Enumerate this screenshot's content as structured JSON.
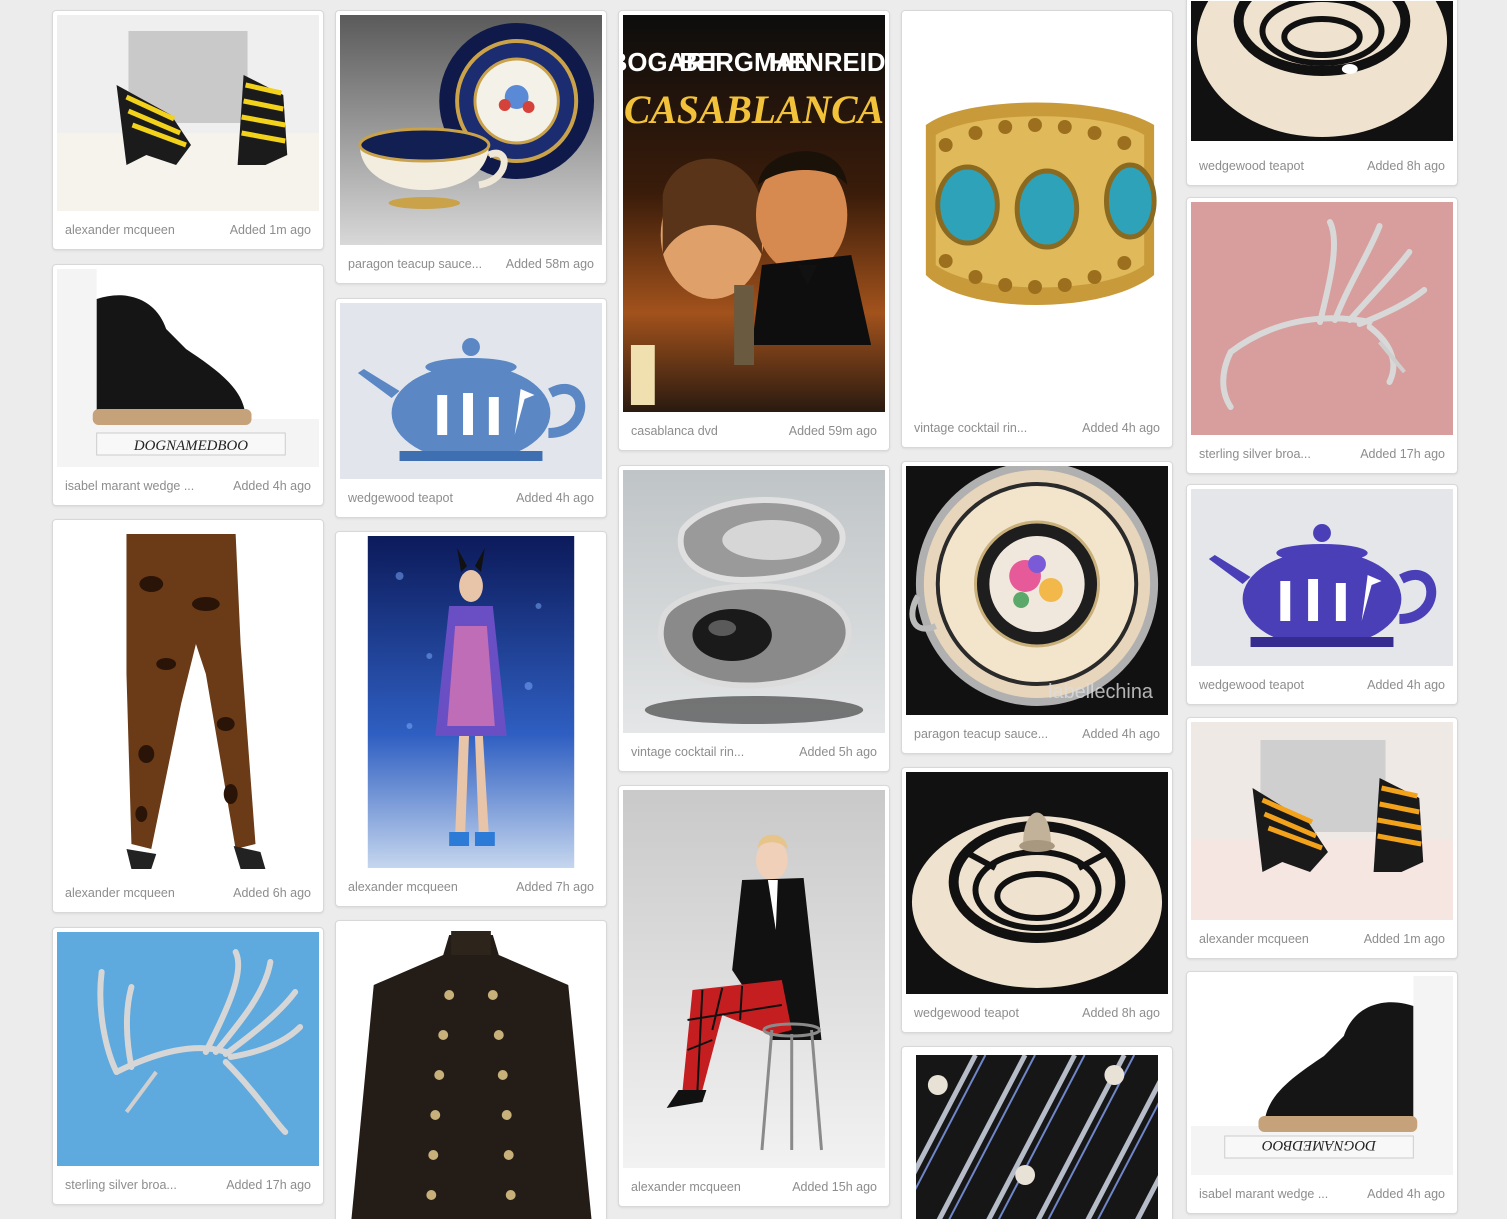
{
  "columns": [
    [
      {
        "title": "alexander mcqueen",
        "added": "Added 1m ago",
        "icon": "yellow-striped-sandals-image"
      },
      {
        "title": "isabel marant wedge ...",
        "added": "Added 4h ago",
        "icon": "black-wedge-sneaker-image",
        "img_text": "DOGNAMEDBOO"
      },
      {
        "title": "alexander mcqueen",
        "added": "Added 6h ago",
        "icon": "animal-print-leggings-image"
      },
      {
        "title": "sterling silver broa...",
        "added": "Added 17h ago",
        "icon": "hummingbird-brooch-image"
      }
    ],
    [
      {
        "title": "paragon teacup sauce...",
        "added": "Added 58m ago",
        "icon": "teacup-saucer-image"
      },
      {
        "title": "wedgewood teapot",
        "added": "Added 4h ago",
        "icon": "blue-teapot-image"
      },
      {
        "title": "alexander mcqueen",
        "added": "Added 7h ago",
        "icon": "runway-model-image"
      },
      {
        "title": "",
        "added": "",
        "icon": "military-leather-jacket-image"
      }
    ],
    [
      {
        "title": "casablanca dvd",
        "added": "Added 59m ago",
        "icon": "casablanca-poster-image",
        "poster": {
          "names": [
            "BOGART",
            "BERGMAN",
            "HENREID"
          ],
          "title": "CASABLANCA"
        }
      },
      {
        "title": "vintage cocktail rin...",
        "added": "Added 5h ago",
        "icon": "silver-cocktail-ring-image"
      },
      {
        "title": "alexander mcqueen",
        "added": "Added 15h ago",
        "icon": "tartan-trousers-model-image"
      }
    ],
    [
      {
        "title": "vintage cocktail rin...",
        "added": "Added 4h ago",
        "icon": "turquoise-gold-ring-image"
      },
      {
        "title": "paragon teacup sauce...",
        "added": "Added 4h ago",
        "icon": "floral-teacup-image",
        "img_text": "labellechina"
      },
      {
        "title": "wedgewood teapot",
        "added": "Added 8h ago",
        "icon": "teapot-lid-image"
      },
      {
        "title": "",
        "added": "",
        "icon": "skull-striped-fabric-image"
      }
    ],
    [
      {
        "title": "wedgewood teapot",
        "added": "Added 8h ago",
        "icon": "teapot-lid-image"
      },
      {
        "title": "sterling silver broa...",
        "added": "Added 17h ago",
        "icon": "hummingbird-brooch-image"
      },
      {
        "title": "wedgewood teapot",
        "added": "Added 4h ago",
        "icon": "purple-teapot-image"
      },
      {
        "title": "alexander mcqueen",
        "added": "Added 1m ago",
        "icon": "orange-striped-sandals-image"
      },
      {
        "title": "isabel marant wedge ...",
        "added": "Added 4h ago",
        "icon": "black-wedge-sneaker-image",
        "img_text": "DOGNAMEDBOO"
      }
    ]
  ]
}
